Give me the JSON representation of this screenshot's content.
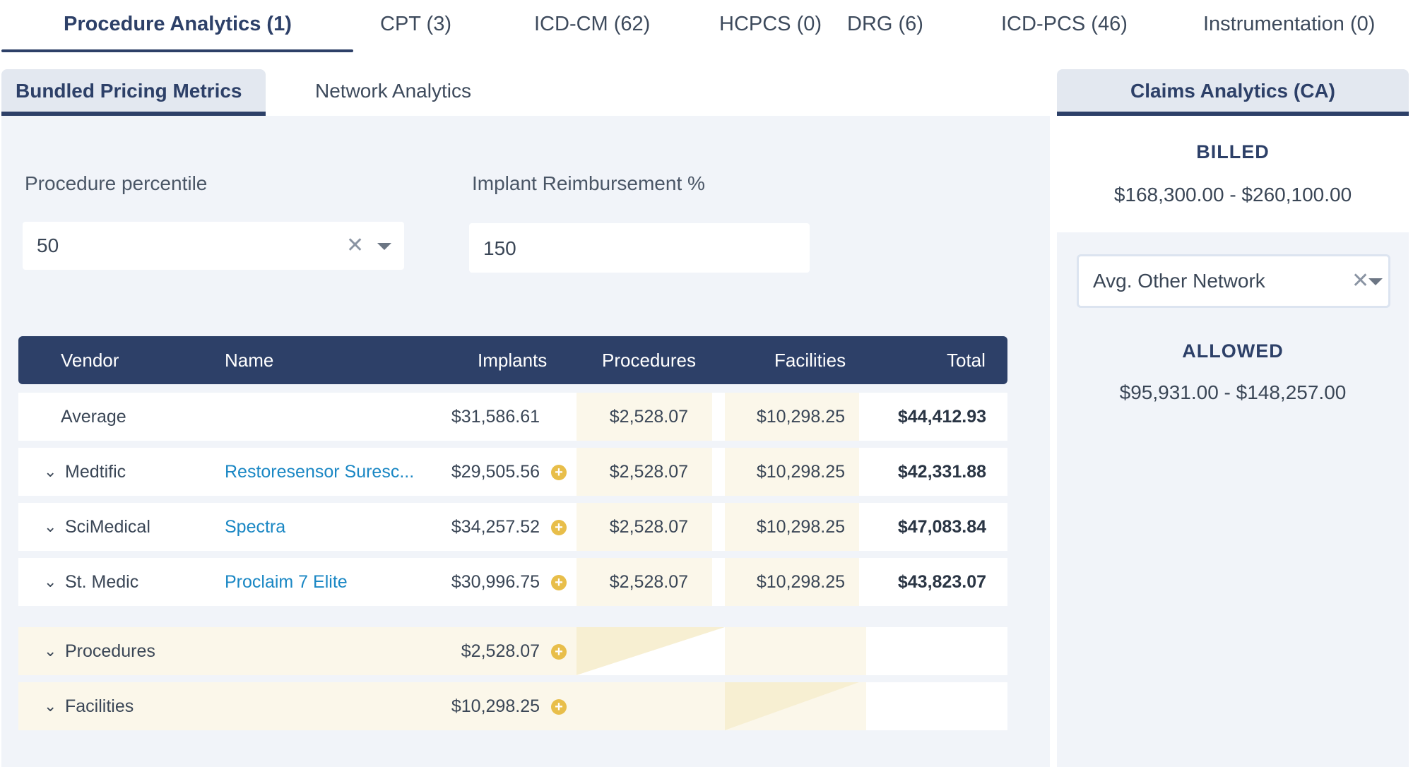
{
  "top_tabs": [
    {
      "label": "Procedure Analytics (1)",
      "active": true
    },
    {
      "label": "CPT (3)"
    },
    {
      "label": "ICD-CM (62)"
    },
    {
      "label": "HCPCS (0)"
    },
    {
      "label": "DRG (6)"
    },
    {
      "label": "ICD-PCS (46)"
    },
    {
      "label": "Instrumentation (0)"
    }
  ],
  "sub_tabs": [
    {
      "label": "Bundled Pricing Metrics",
      "active": true
    },
    {
      "label": "Network Analytics"
    }
  ],
  "filters": {
    "percentile_label": "Procedure percentile",
    "percentile_value": "50",
    "reimb_label": "Implant Reimbursement %",
    "reimb_value": "150"
  },
  "table": {
    "headers": {
      "vendor": "Vendor",
      "name": "Name",
      "implants": "Implants",
      "procedures": "Procedures",
      "facilities": "Facilities",
      "total": "Total"
    },
    "average": {
      "vendor": "Average",
      "implants": "$31,586.61",
      "procedures": "$2,528.07",
      "facilities": "$10,298.25",
      "total": "$44,412.93"
    },
    "rows": [
      {
        "vendor": "Medtific",
        "name": "Restoresensor Suresc...",
        "implants": "$29,505.56",
        "procedures": "$2,528.07",
        "facilities": "$10,298.25",
        "total": "$42,331.88"
      },
      {
        "vendor": "SciMedical",
        "name": "Spectra",
        "implants": "$34,257.52",
        "procedures": "$2,528.07",
        "facilities": "$10,298.25",
        "total": "$47,083.84"
      },
      {
        "vendor": "St. Medic",
        "name": "Proclaim 7 Elite",
        "implants": "$30,996.75",
        "procedures": "$2,528.07",
        "facilities": "$10,298.25",
        "total": "$43,823.07"
      }
    ],
    "summary": [
      {
        "label": "Procedures",
        "value": "$2,528.07"
      },
      {
        "label": "Facilities",
        "value": "$10,298.25"
      }
    ]
  },
  "claims": {
    "title": "Claims Analytics (CA)",
    "billed_label": "BILLED",
    "billed_value": "$168,300.00 - $260,100.00",
    "network_value": "Avg. Other Network",
    "allowed_label": "ALLOWED",
    "allowed_value": "$95,931.00 - $148,257.00"
  },
  "icons": {
    "clear": "✕",
    "chevron": "⌄",
    "plus": "+"
  },
  "colors": {
    "primary": "#2d4068",
    "link": "#1a87c4",
    "accent": "#e8be4a",
    "shade": "#fbf7ea"
  }
}
